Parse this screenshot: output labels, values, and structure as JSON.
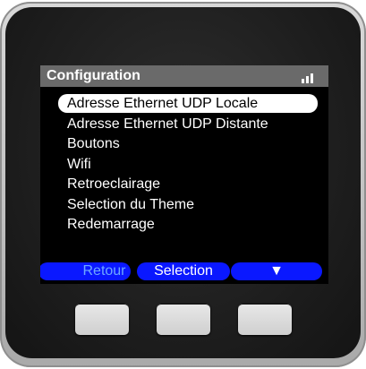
{
  "screen": {
    "title": "Configuration",
    "signal_icon": "signal-bars-icon"
  },
  "menu": {
    "selected_index": 0,
    "items": [
      "Adresse Ethernet UDP Locale",
      "Adresse Ethernet UDP Distante",
      "Boutons",
      "Wifi",
      "Retroeclairage",
      "Selection du Theme",
      "Redemarrage"
    ]
  },
  "softkeys": {
    "left": "Retour",
    "middle": "Selection",
    "right": "▼"
  },
  "colors": {
    "softkey_bg": "#0a18ff",
    "titlebar_bg": "#6a6a6a",
    "screen_bg": "#000000"
  }
}
